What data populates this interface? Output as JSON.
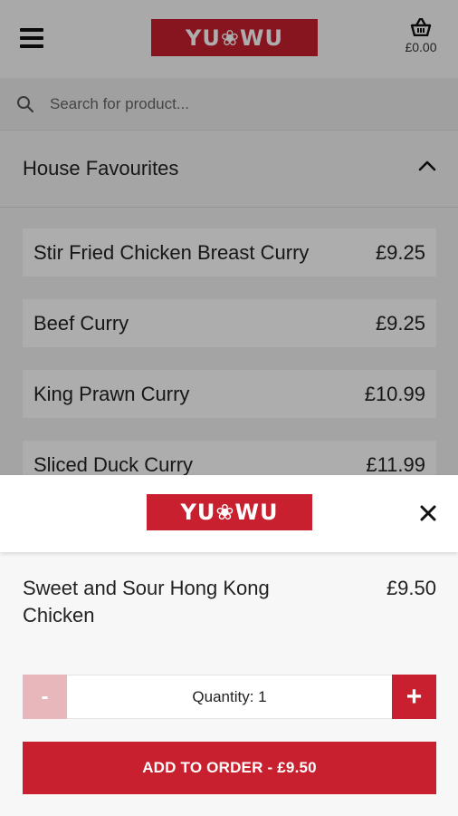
{
  "header": {
    "logo_text": "YU❀WU",
    "basket_amount": "£0.00"
  },
  "search": {
    "placeholder": "Search for product..."
  },
  "section": {
    "title": "House Favourites"
  },
  "menu_items": [
    {
      "name": "Stir Fried Chicken Breast Curry",
      "price": "£9.25"
    },
    {
      "name": "Beef Curry",
      "price": "£9.25"
    },
    {
      "name": "King Prawn Curry",
      "price": "£10.99"
    },
    {
      "name": "Sliced Duck Curry",
      "price": "£11.99"
    }
  ],
  "sheet": {
    "logo_text": "YU❀WU",
    "product_name": "Sweet and Sour Hong Kong Chicken",
    "product_price": "£9.50",
    "minus_label": "-",
    "plus_label": "+",
    "quantity_text": "Quantity:  1",
    "add_button_label": "ADD TO ORDER  -  £9.50"
  },
  "colors": {
    "brand_red": "#c8202e",
    "disabled_red": "#e8b7bc"
  }
}
